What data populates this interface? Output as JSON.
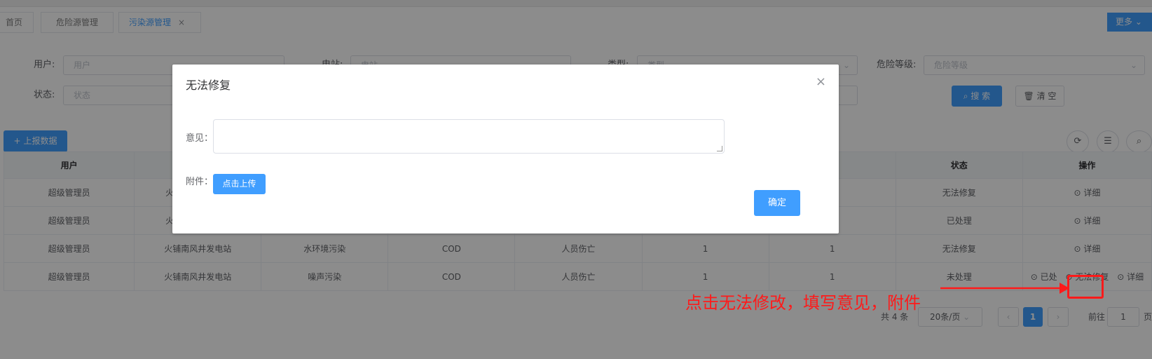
{
  "tabs": [
    {
      "label": "首页"
    },
    {
      "label": "危险源管理"
    },
    {
      "label": "污染源管理",
      "close": "×"
    }
  ],
  "more_button": {
    "label": "更多",
    "chevron": "⌄"
  },
  "filters": {
    "user": {
      "label": "用户:",
      "placeholder": "用户"
    },
    "field2": {
      "label": "电站:",
      "placeholder": "电站"
    },
    "type": {
      "label": "类型:",
      "placeholder": "类型"
    },
    "risk_level": {
      "label": "危险等级:",
      "placeholder": "危险等级"
    },
    "status": {
      "label": "状态:",
      "placeholder": "状态"
    }
  },
  "search_button": {
    "label": "搜 索",
    "icon": "search-icon"
  },
  "clear_button": {
    "label": "清 空",
    "icon": "trash-icon"
  },
  "report_button": {
    "label": "上报数据",
    "icon": "plus-icon"
  },
  "table": {
    "headers": [
      "用户",
      "",
      "",
      "",
      "",
      "",
      "",
      "状态",
      "操作"
    ],
    "rows": [
      [
        "超级管理员",
        "火",
        "",
        "",
        "",
        "",
        "",
        "无法修复",
        "详细"
      ],
      [
        "超级管理员",
        "火",
        "",
        "",
        "",
        "",
        "",
        "已处理",
        "详细"
      ],
      [
        "超级管理员",
        "火铺南风井发电站",
        "水环境污染",
        "COD",
        "人员伤亡",
        "1",
        "1",
        "无法修复",
        "详细"
      ],
      [
        "超级管理员",
        "火铺南风井发电站",
        "噪声污染",
        "COD",
        "人员伤亡",
        "1",
        "1",
        "未处理",
        "已处",
        "无法修复",
        "详细"
      ]
    ]
  },
  "pagination": {
    "total": "共 4 条",
    "page_size": "20条/页",
    "current_page": "1",
    "goto_label": "前往",
    "goto_value": "1",
    "page_suffix": "页"
  },
  "dialog": {
    "title": "无法修复",
    "close": "×",
    "opinion_label": "意见：",
    "attachment_label": "附件：",
    "upload_button": "点击上传",
    "confirm_button": "确定"
  },
  "annotation": {
    "text": "点击无法修改，填写意见，附件",
    "color": "#ff1a1a"
  },
  "colors": {
    "primary": "#409eff",
    "annotation": "#ff1a1a"
  }
}
